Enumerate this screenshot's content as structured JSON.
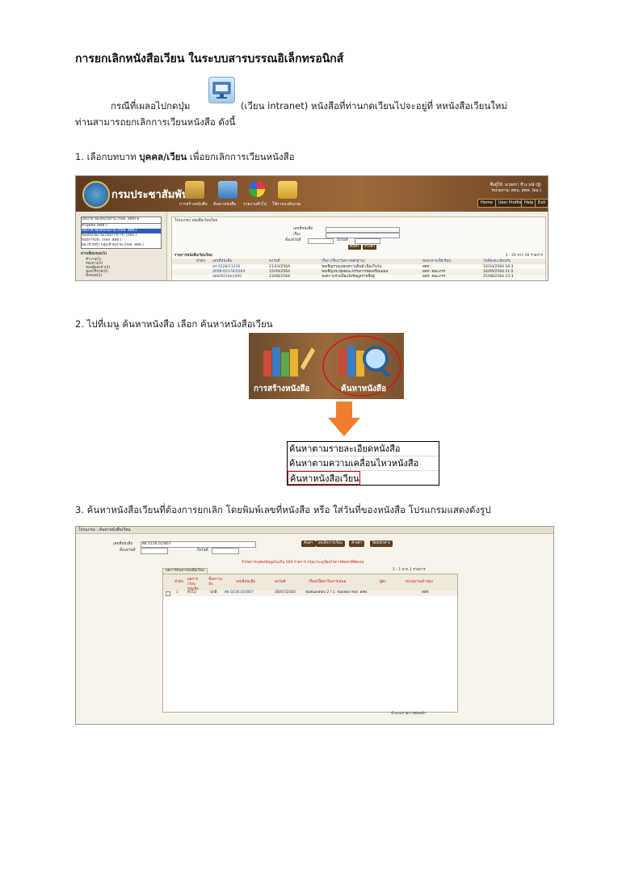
{
  "title": "การยกเลิกหนังสือเวียน ในระบบสารบรรณอิเล็กทรอนิกส์",
  "intro": {
    "line1_a": "กรณีที่เผลอไปกดปุ่ม",
    "line1_b": "(เวียน intranet) หนังสือที่ท่านกดเวียนไปจะอยู่ที่ หหนังสือเวียนใหม่",
    "line2": "ท่านสามารถยกเลิกการเวียนหนังสือ ดังนี้"
  },
  "step1": {
    "prefix": "1.  เลือกบทบาท ",
    "bold": "บุคคล/เวียน",
    "suffix": " เพื่อยกเลิกการเวียนหนังสือ"
  },
  "step2": "2.  ไปที่เมนู ค้นหาหนังสือ เลือก ค้นหาหนังสือเวียน",
  "step3": "3.  ค้นหาหนังสือเวียนที่ต้องการยกเลิก โดยพิมพ์เลขที่หนังสือ หรือ ใส่วันที่ของหนังสือ โปรแกรมแสดงดังรูป",
  "shot1": {
    "logo": "กรมประชาสัมพันธ์",
    "toolbar": [
      "การสร้างหนังสือ",
      "ค้นหาหนังสือ",
      "รายงานทั่วไป",
      "ใช้งานระดับกรม"
    ],
    "buttons": [
      "Home",
      "User Profile",
      "Help",
      "Exit"
    ],
    "user": [
      "ชื่อผู้ใช้: นายสรา ชีวะวงษ์ (ผู้)",
      "หน่วยงาน: สทน. สทท. (ผอ.)"
    ],
    "role_select": "บทบาท:ของหน่วยงาน (กพจ. สสท) ▾",
    "roles": [
      "ตัวบุคคล (สสส.)",
      "บทบาท:ของหน่วยงาน (กพจ. สสท.)",
      "ของหน่วยงาน(ปรุงการการ) (กพจ.)",
      "ของการประ (กพจ. สสท.)",
      "ผอ./หัวหน้า กลุ่ม/ฝ่าย/งาน (กพจ. สสท.)"
    ],
    "side_items": [
      "สารเลี่ยนรอง(5)",
      "ทำงาน(5)",
      "รองทวง(0)",
      "ของผู้มองหา(4)",
      "ของบริจาค(0)",
      "ทั้งหมด(2)",
      "หนังสือเวียน",
      "หนังสือเวียนใหม่(26)"
    ],
    "crumb": "โปรแกรม: หนังสือเวียนใหม่",
    "list_title": "รายการหนังสือเวียนใหม่",
    "paging": "1 - 20 จาก 26 รายการ",
    "columns": [
      "ลำดับ",
      "เลขที่หนังสือ",
      "ลงวันที่",
      "เรื่อง (เรื่อง/วันทางหลักฐาน)",
      "ของกลางเพื่อเรียน",
      "วันที่ลงทะเบียนรับ"
    ],
    "rows": [
      [
        "นร 0228/11216",
        "11/10/2564",
        "ขอเชิญร่วมแสดงความยินดี เนื่องในวัน",
        "สสท.",
        "12/10/2564 16:3"
      ],
      [
        "2698-05176/2564",
        "15/09/2564",
        "ขอเชิญประชุมคณะกรรมการจัดเตรียมแผน",
        "สสท. คณะกรร",
        "16/09/2564 11:5"
      ],
      [
        "สสธ062(สธ)/400",
        "23/08/2564",
        "ขอความร่วมมือแจ้งข้อมูลรายชื่อผู้",
        "สสท. คณะกรร",
        "25/08/2564 15:3"
      ],
      [
        "นร 0217.05/338",
        "24/08/2564",
        "ขอเชิญสมัครเข้าร่วมโครงการ",
        "สสท. คณะกรร",
        "26/08/2564 11:1"
      ]
    ],
    "search_labels": [
      "เลขที่หนังสือ",
      "เรื่อง",
      "ตั้งแต่วันที่",
      "ถึงวันที่"
    ],
    "search_btn": "ค้นหา",
    "clear_btn": "ล้างค่า"
  },
  "shot2": {
    "left_label": "การสร้างหนังสือ",
    "right_label": "ค้นหาหนังสือ"
  },
  "menu": [
    "ค้นหาตามรายละเอียดหนังสือ",
    "ค้นหาตามความเคลื่อนไหวหนังสือ",
    "ค้นหาหนังสือเวียน"
  ],
  "shot3": {
    "crumb": "โปรแกรม : ค้นหาหนังสือเวียน",
    "doc_no_label": "เลขที่หนังสือ",
    "doc_no_value": "ศธ 0236.02/867",
    "from_label": "ตั้งแต่วันที่",
    "to_label": "ถึงวันที่",
    "buttons": [
      "ค้นหา",
      "ยกเลิกการเวียน",
      "ล้างค่า",
      "ปิดหน้าต่าง"
    ],
    "note": "จำกัดการแสดงข้อมูลไม่เกิน 500 รายการ กรุณาระบุเงื่อนไขการค้นหาที่ชัดเจน",
    "tab": "ผลการค้นหาหนังสือเวียน",
    "paging": "1 - 1 จาก 1 รายการ",
    "columns": [
      "ลำดับ",
      "ผลการเวียนหนังสือ",
      "ชั้นความลับ",
      "เลขที่หนังสือ",
      "ลงวันที่",
      "เรื่อง/เนื้อหาในการเสนอ",
      "ผู้ส่ง",
      "หน่วยงานเจ้าของ"
    ],
    "row": [
      "1",
      "ทั่วไป",
      "ปกติ",
      "ศธ 0236.02/867",
      "30/07/2564",
      "ขอสนองตอบ 2 / 1. ของสอง กพจ. สสท.",
      "",
      "สสท."
    ],
    "footer": "จำนวนรายการต่อหน้า"
  }
}
